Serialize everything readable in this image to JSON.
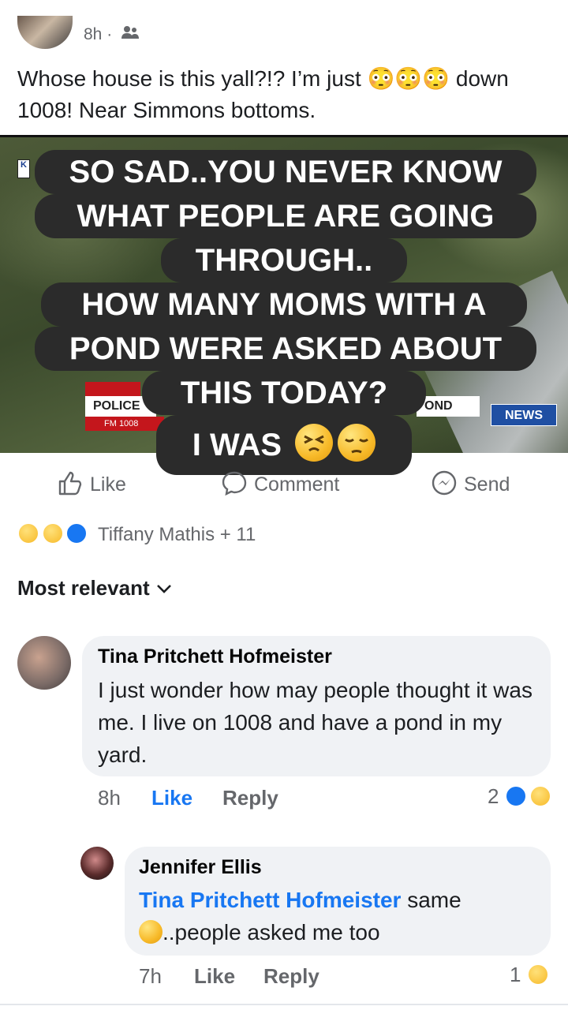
{
  "post": {
    "time": "8h ·",
    "audience_icon": "friends-icon",
    "text": "Whose house is this yall?!? I’m just 😳😳😳 down 1008! Near Simmons bottoms."
  },
  "media": {
    "lower_third_top": "",
    "lower_third_left": "POLICE",
    "lower_third_left_sub": "FM 1008",
    "lower_third_right": "OND",
    "news_logo": "NEWS",
    "caption_lines": [
      "SO SAD..YOU NEVER KNOW",
      "WHAT PEOPLE ARE GOING",
      "THROUGH..",
      "HOW MANY MOMS WITH A",
      "POND WERE ASKED ABOUT",
      "THIS TODAY?",
      "I WAS"
    ]
  },
  "actions": {
    "like": "Like",
    "comment": "Comment",
    "send": "Send"
  },
  "reactions": {
    "summary": "Tiffany Mathis + 11",
    "colors": [
      "#f7b928",
      "#f7b928",
      "#1877f2"
    ]
  },
  "sort": {
    "label": "Most relevant"
  },
  "comments": [
    {
      "author": "Tina Pritchett Hofmeister",
      "text": "I just wonder how may people thought it was me. I live on 1008 and have a pond in my yard.",
      "time": "8h",
      "like": "Like",
      "reply": "Reply",
      "reaction_count": "2"
    },
    {
      "author": "Jennifer Ellis",
      "mention": "Tina Pritchett Hofmeister",
      "text_after_mention": " same",
      "text_line2": "..people asked me too",
      "time": "7h",
      "like": "Like",
      "reply": "Reply",
      "reaction_count": "1"
    }
  ]
}
